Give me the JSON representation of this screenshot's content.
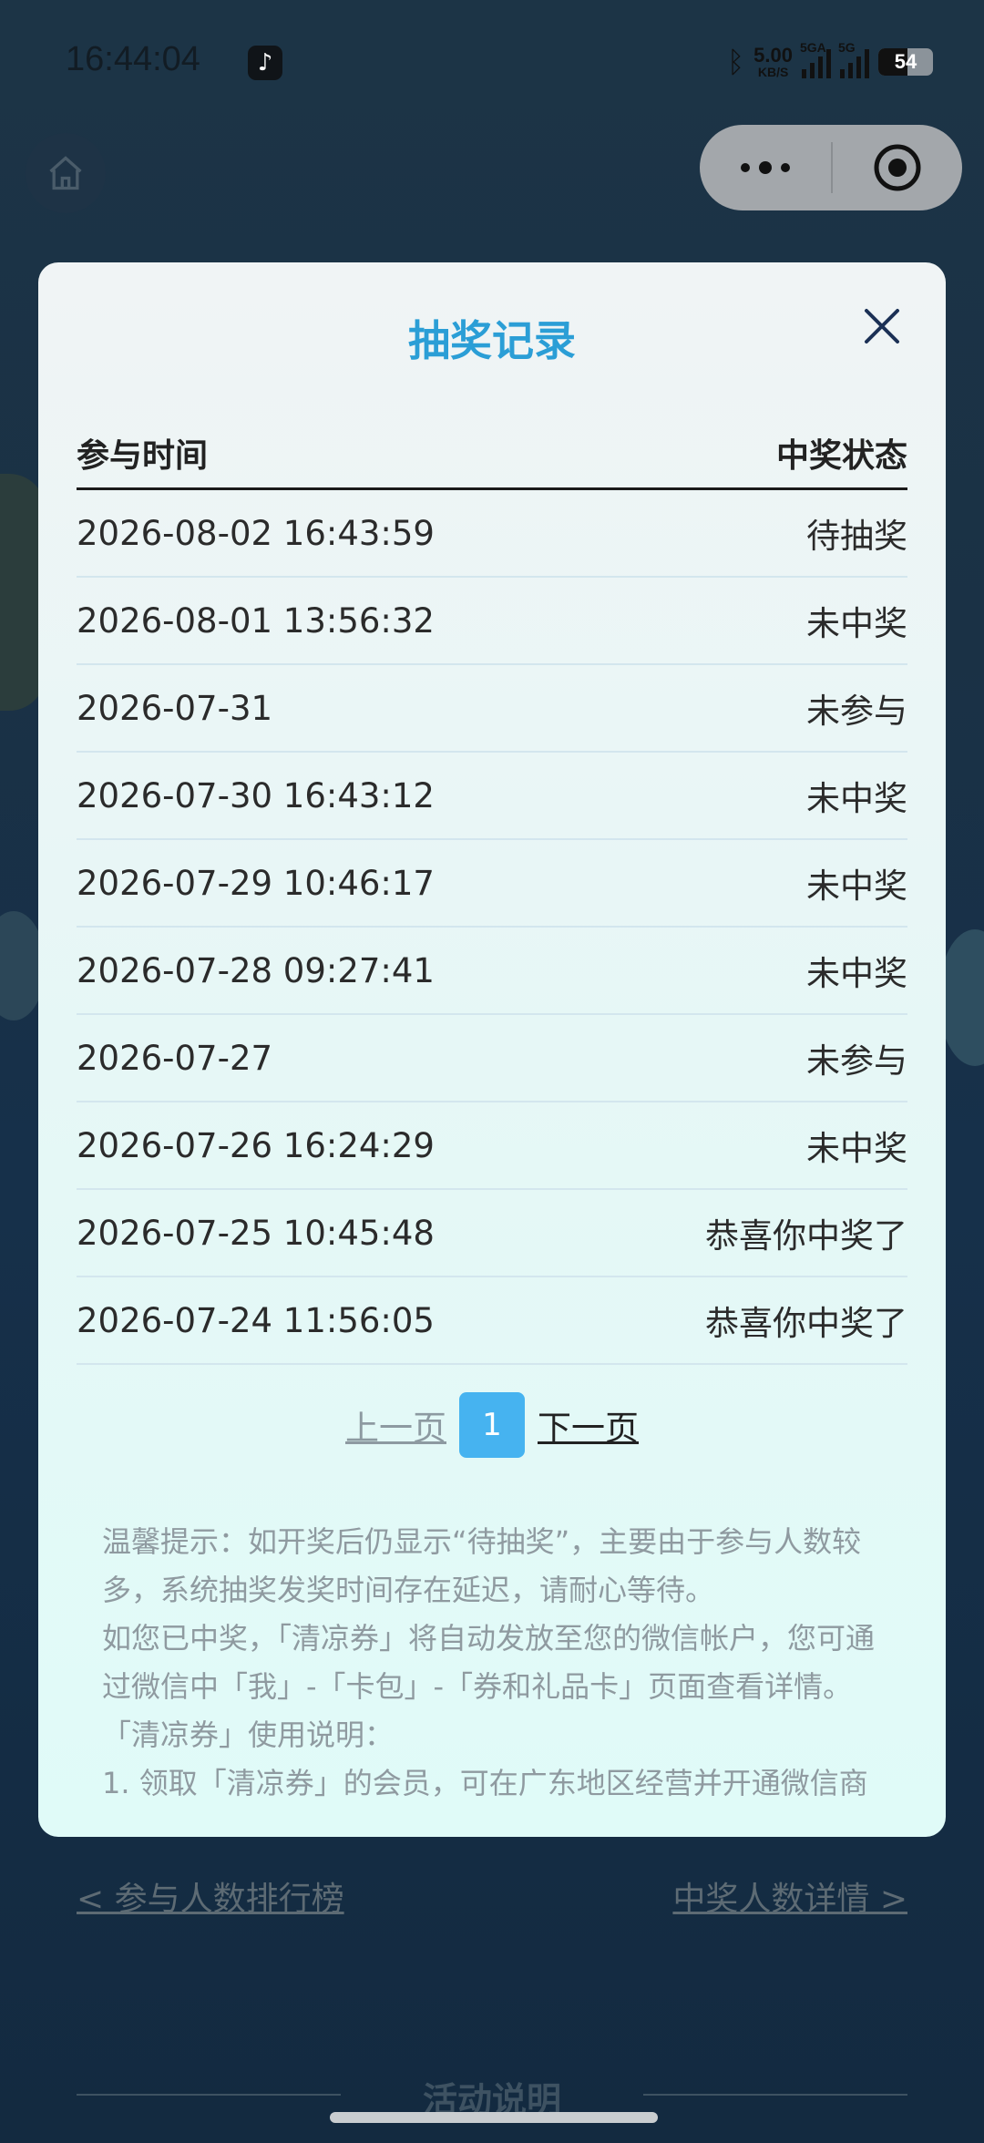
{
  "status_bar": {
    "time": "16:44:04",
    "network_speed_value": "5.00",
    "network_speed_unit": "KB/S",
    "signal1_label": "5GA",
    "signal2_label": "5G",
    "battery_level": "54"
  },
  "modal": {
    "title": "抽奖记录",
    "header_time": "参与时间",
    "header_status": "中奖状态",
    "records": [
      {
        "time": "2026-08-02 16:43:59",
        "status": "待抽奖"
      },
      {
        "time": "2026-08-01 13:56:32",
        "status": "未中奖"
      },
      {
        "time": "2026-07-31",
        "status": "未参与"
      },
      {
        "time": "2026-07-30 16:43:12",
        "status": "未中奖"
      },
      {
        "time": "2026-07-29 10:46:17",
        "status": "未中奖"
      },
      {
        "time": "2026-07-28 09:27:41",
        "status": "未中奖"
      },
      {
        "time": "2026-07-27",
        "status": "未参与"
      },
      {
        "time": "2026-07-26 16:24:29",
        "status": "未中奖"
      },
      {
        "time": "2026-07-25 10:45:48",
        "status": "恭喜你中奖了"
      },
      {
        "time": "2026-07-24 11:56:05",
        "status": "恭喜你中奖了"
      }
    ],
    "pager": {
      "prev_label": "上一页",
      "current_page": "1",
      "next_label": "下一页"
    },
    "notes": [
      "温馨提示：如开奖后仍显示“待抽奖”，主要由于参与人数较多，系统抽奖发奖时间存在延迟，请耐心等待。",
      "如您已中奖，「清凉券」将自动发放至您的微信帐户，您可通过微信中「我」-「卡包」-「券和礼品卡」页面查看详情。",
      "「清凉券」使用说明：",
      "1. 领取「清凉券」的会员，可在广东地区经营并开通微信商"
    ]
  },
  "background": {
    "link_left": "< 参与人数排行榜",
    "link_right": "中奖人数详情 >",
    "section_title": "活动说明"
  },
  "colors": {
    "title_accent": "#2b9ed6",
    "page_active": "#46b3f0",
    "overlay": "#13273a"
  }
}
